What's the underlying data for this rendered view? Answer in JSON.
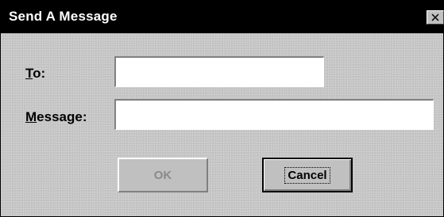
{
  "window": {
    "title": "Send A Message",
    "close_symbol": "×"
  },
  "form": {
    "to": {
      "label_accel": "T",
      "label_rest": "o:",
      "value": ""
    },
    "message": {
      "label_accel": "M",
      "label_rest": "essage:",
      "value": ""
    }
  },
  "buttons": {
    "ok": {
      "label": "OK",
      "enabled": false
    },
    "cancel": {
      "label": "Cancel",
      "focused": true
    }
  },
  "colors": {
    "titlebar": "#000000",
    "title_text": "#ffffff",
    "dialog_face": "#c6c6c6",
    "disabled_text": "#8a8a8a"
  }
}
